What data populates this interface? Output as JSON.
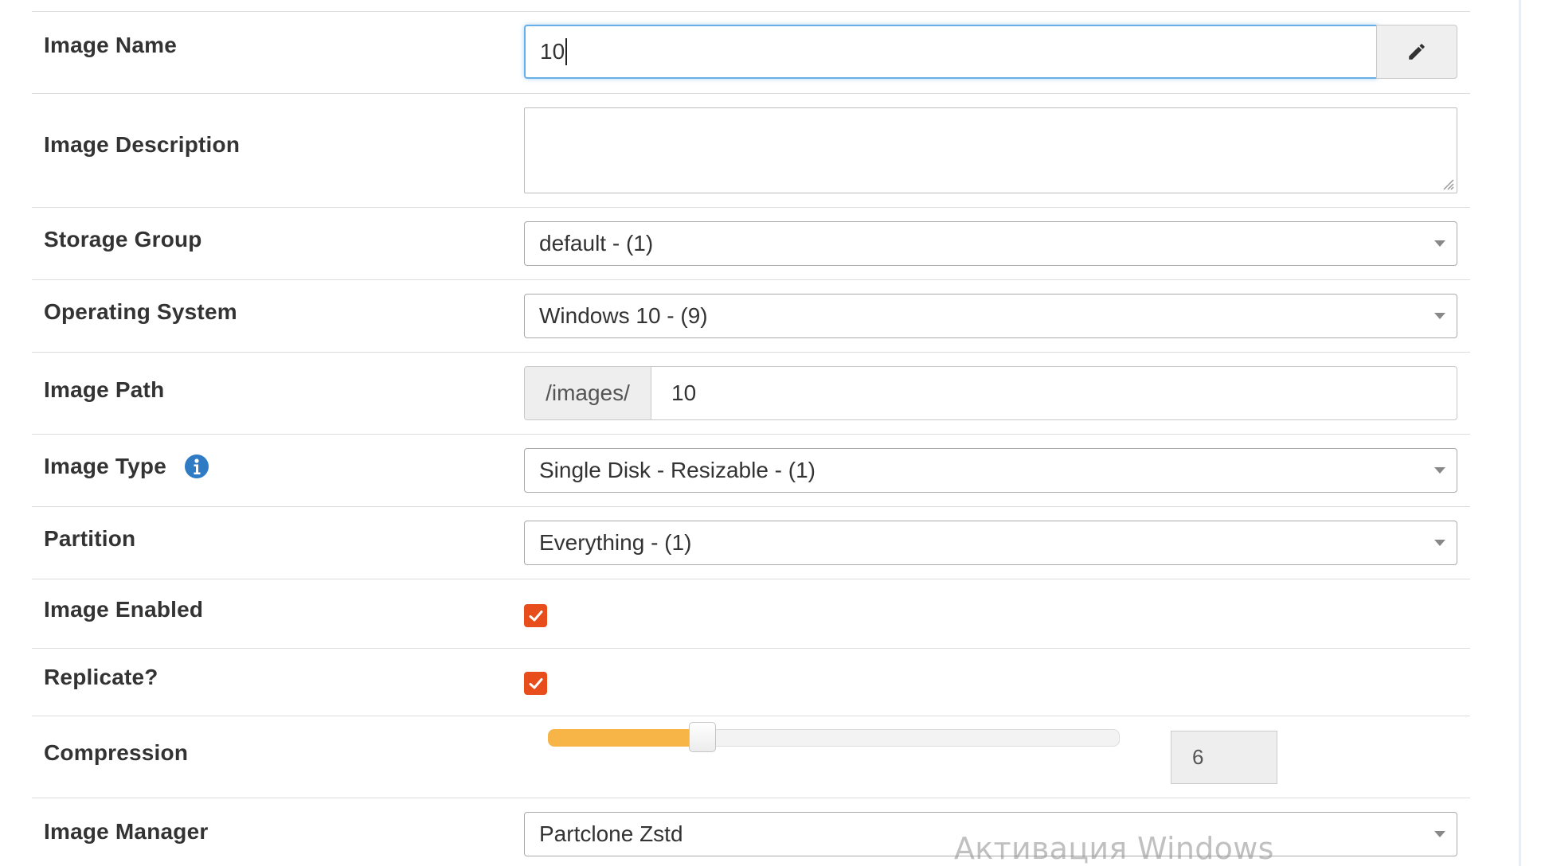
{
  "form": {
    "image_name": {
      "label": "Image Name",
      "value": "10"
    },
    "image_description": {
      "label": "Image Description",
      "value": ""
    },
    "storage_group": {
      "label": "Storage Group",
      "selected": "default - (1)"
    },
    "operating_system": {
      "label": "Operating System",
      "selected": "Windows 10 - (9)"
    },
    "image_path": {
      "label": "Image Path",
      "prefix": "/images/",
      "value": "10"
    },
    "image_type": {
      "label": "Image Type",
      "selected": "Single Disk - Resizable - (1)",
      "info_icon": "info-circle-icon"
    },
    "partition": {
      "label": "Partition",
      "selected": "Everything - (1)"
    },
    "image_enabled": {
      "label": "Image Enabled",
      "checked": true
    },
    "replicate": {
      "label": "Replicate?",
      "checked": true
    },
    "compression": {
      "label": "Compression",
      "value": "6",
      "min": 0,
      "max": 22,
      "fraction": 0.27
    },
    "image_manager": {
      "label": "Image Manager",
      "selected": "Partclone Zstd"
    }
  },
  "watermark": {
    "text": "Активация Windows"
  },
  "colors": {
    "checkbox": "#e84d1c",
    "slider_fill": "#f7b548",
    "focus_border": "#66afe9",
    "info_icon": "#2f7bc4"
  }
}
